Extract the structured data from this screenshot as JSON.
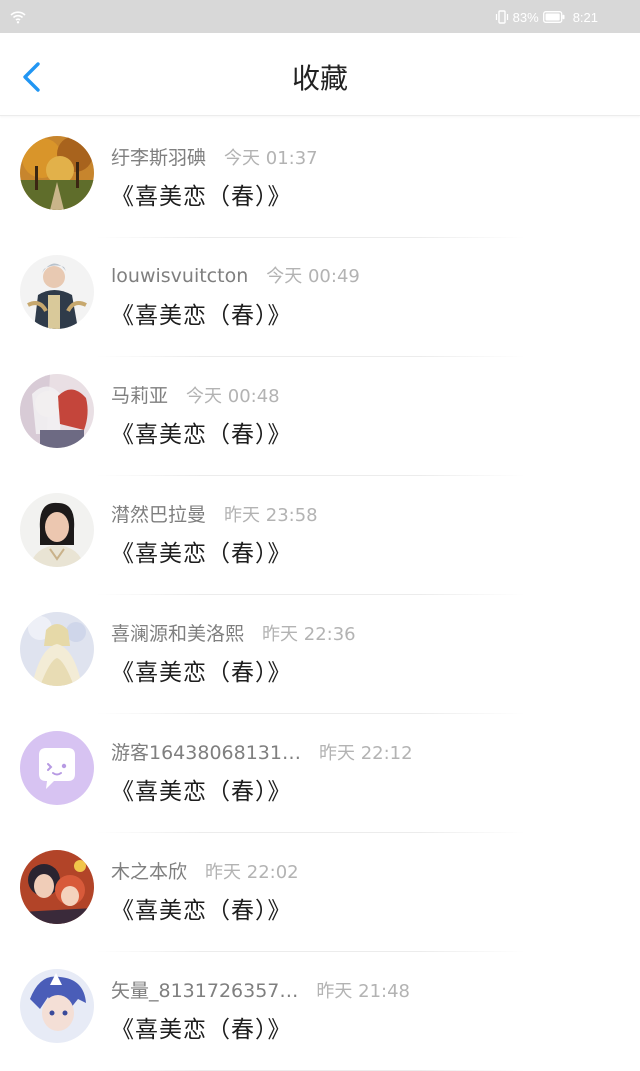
{
  "status_bar": {
    "battery": "83%",
    "clock": "8:21",
    "icons": [
      "wifi-icon",
      "vibrate-icon",
      "battery-icon"
    ]
  },
  "header": {
    "title": "收藏",
    "back_icon": "chevron-left-icon"
  },
  "colors": {
    "accent": "#2196f3",
    "status_bar_bg": "#d8d8d8",
    "username": "#7f7f7f",
    "time": "#b3b3b3",
    "title_text": "#1e1e1e"
  },
  "favorites": [
    {
      "user": "纡李斯羽碘",
      "time": "今天 01:37",
      "title": "《喜美恋（春）》"
    },
    {
      "user": "louwisvuitcton",
      "time": "今天 00:49",
      "title": "《喜美恋（春）》"
    },
    {
      "user": "马莉亚",
      "time": "今天 00:48",
      "title": "《喜美恋（春）》"
    },
    {
      "user": "潸然巴拉曼",
      "time": "昨天 23:58",
      "title": "《喜美恋（春）》"
    },
    {
      "user": "喜澜源和美洛熙",
      "time": "昨天 22:36",
      "title": "《喜美恋（春）》"
    },
    {
      "user": "游客16438068131…",
      "time": "昨天 22:12",
      "title": "《喜美恋（春）》"
    },
    {
      "user": "木之本欣",
      "time": "昨天 22:02",
      "title": "《喜美恋（春）》"
    },
    {
      "user": "矢量_8131726357…",
      "time": "昨天 21:48",
      "title": "《喜美恋（春）》"
    }
  ]
}
